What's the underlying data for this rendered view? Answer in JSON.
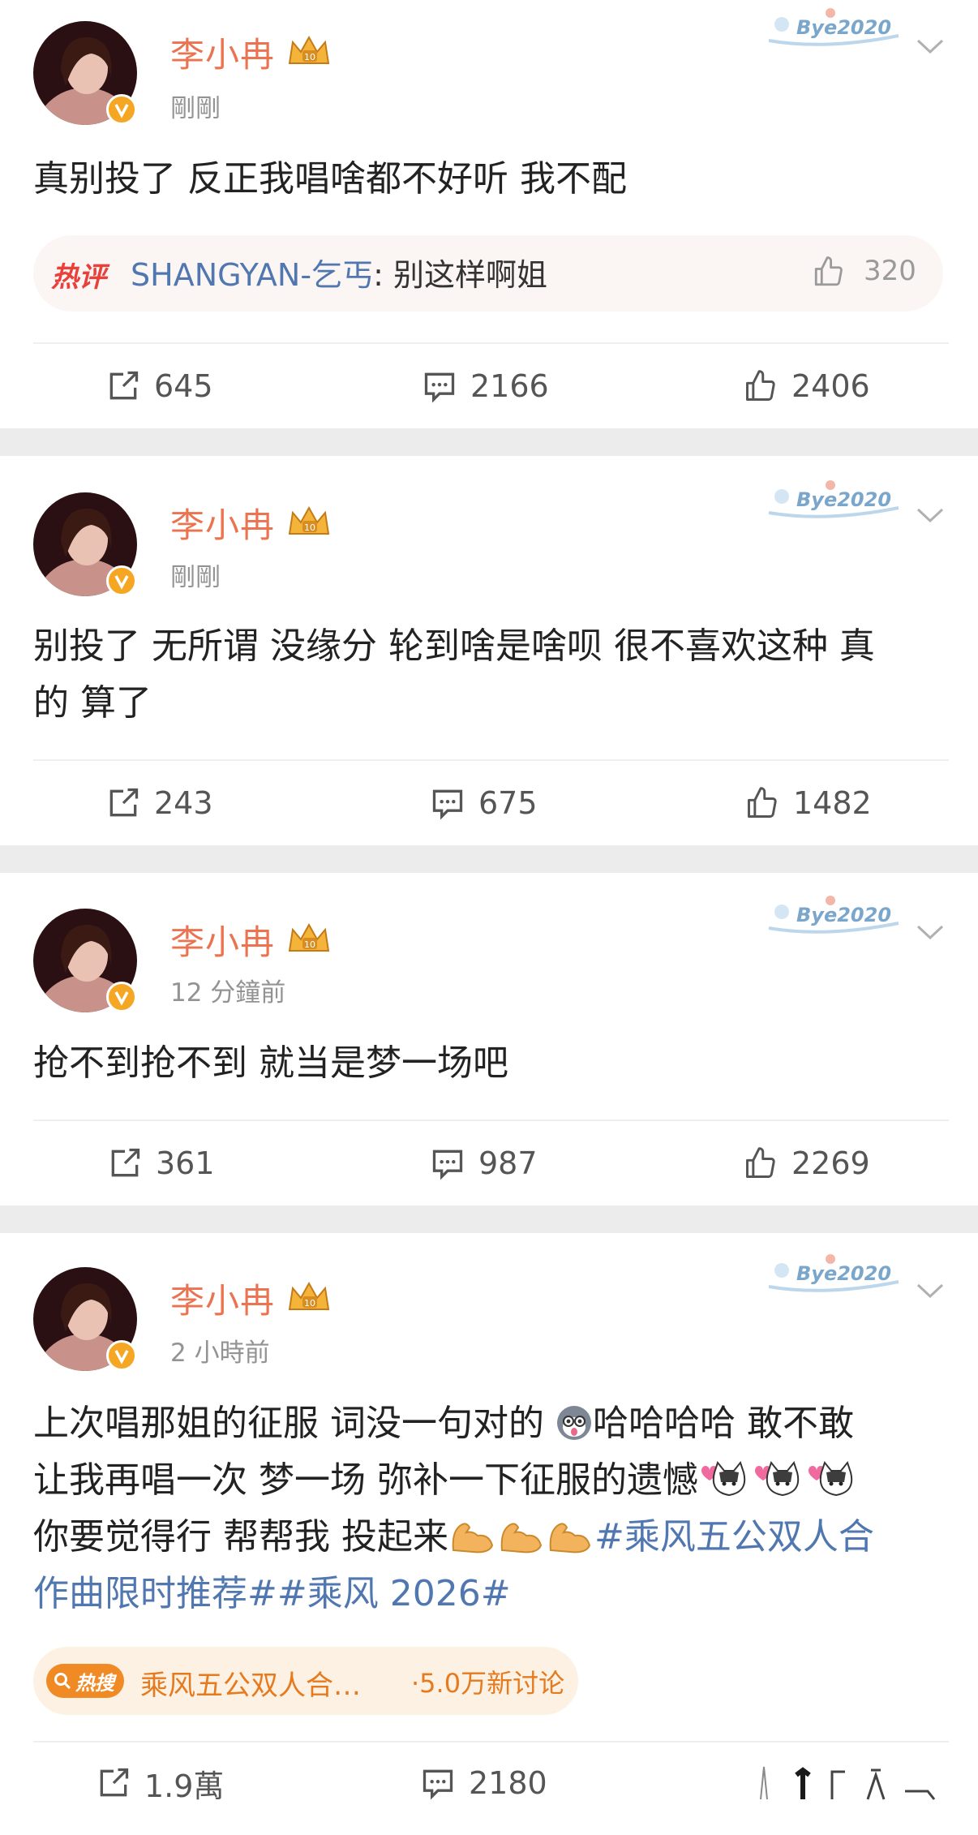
{
  "colors": {
    "username": "#eb7350",
    "verified_badge": "#f5a623",
    "hot_comment_label": "#e8413c",
    "hashtag": "#5177b0",
    "trend_orange": "#f08a24",
    "meta_gray": "#939393"
  },
  "posts": [
    {
      "username": "李小冉",
      "time": "剛剛",
      "deco": "Bye2020",
      "text": "真别投了 反正我唱啥都不好听 我不配",
      "hot_comment": {
        "label": "热评",
        "author": "SHANGYAN-乞丐",
        "text": ": 别这样啊姐",
        "likes": "320"
      },
      "reposts": "645",
      "comments": "2166",
      "likes": "2406"
    },
    {
      "username": "李小冉",
      "time": "剛剛",
      "deco": "Bye2020",
      "text_line1": "别投了 无所谓 没缘分 轮到啥是啥呗 很不喜欢这种 真",
      "text_line2": "的 算了",
      "reposts": "243",
      "comments": "675",
      "likes": "1482"
    },
    {
      "username": "李小冉",
      "time": "12 分鐘前",
      "deco": "Bye2020",
      "text": "抢不到抢不到 就当是梦一场吧",
      "reposts": "361",
      "comments": "987",
      "likes": "2269"
    },
    {
      "username": "李小冉",
      "time": "2 小時前",
      "deco": "Bye2020",
      "line1_a": "上次唱那姐的征服 词没一句对的 ",
      "line1_b": "哈哈哈哈 敢不敢",
      "line2": "让我再唱一次 梦一场 弥补一下征服的遗憾",
      "line3_text": "你要觉得行 帮帮我 投起来",
      "line3_tag": "#乘风五公双人合",
      "line4_tag": "作曲限时推荐##乘风 2026#",
      "trend": {
        "badge": "热搜",
        "title": "乘风五公双人合…",
        "count": "·5.0万新讨论"
      },
      "reposts": "1.9萬",
      "comments": "2180",
      "likes": ""
    }
  ]
}
